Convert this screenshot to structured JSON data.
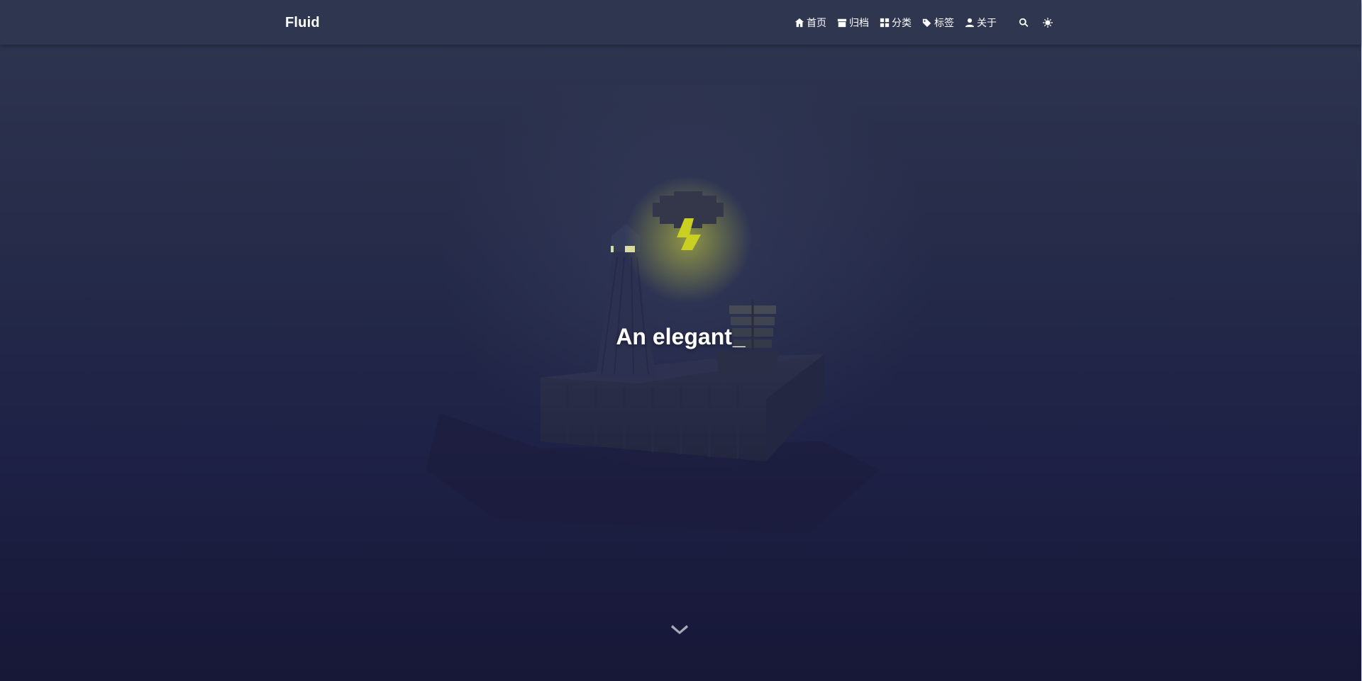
{
  "brand": {
    "name": "Fluid"
  },
  "nav": {
    "items": [
      {
        "label": "首页",
        "icon": "home-icon"
      },
      {
        "label": "归档",
        "icon": "archive-icon"
      },
      {
        "label": "分类",
        "icon": "category-icon"
      },
      {
        "label": "标签",
        "icon": "tags-icon"
      },
      {
        "label": "关于",
        "icon": "user-icon"
      }
    ],
    "search_icon": "search-icon",
    "theme_icon": "sun-icon"
  },
  "hero": {
    "headline": "An elegant",
    "cursor": "_",
    "scroll_icon": "chevron-down-icon"
  },
  "colors": {
    "navbar": "#2f3650",
    "background_top": "#2f3650",
    "background_bottom": "#171737",
    "lightning": "#c9d021",
    "text": "#ffffff"
  }
}
